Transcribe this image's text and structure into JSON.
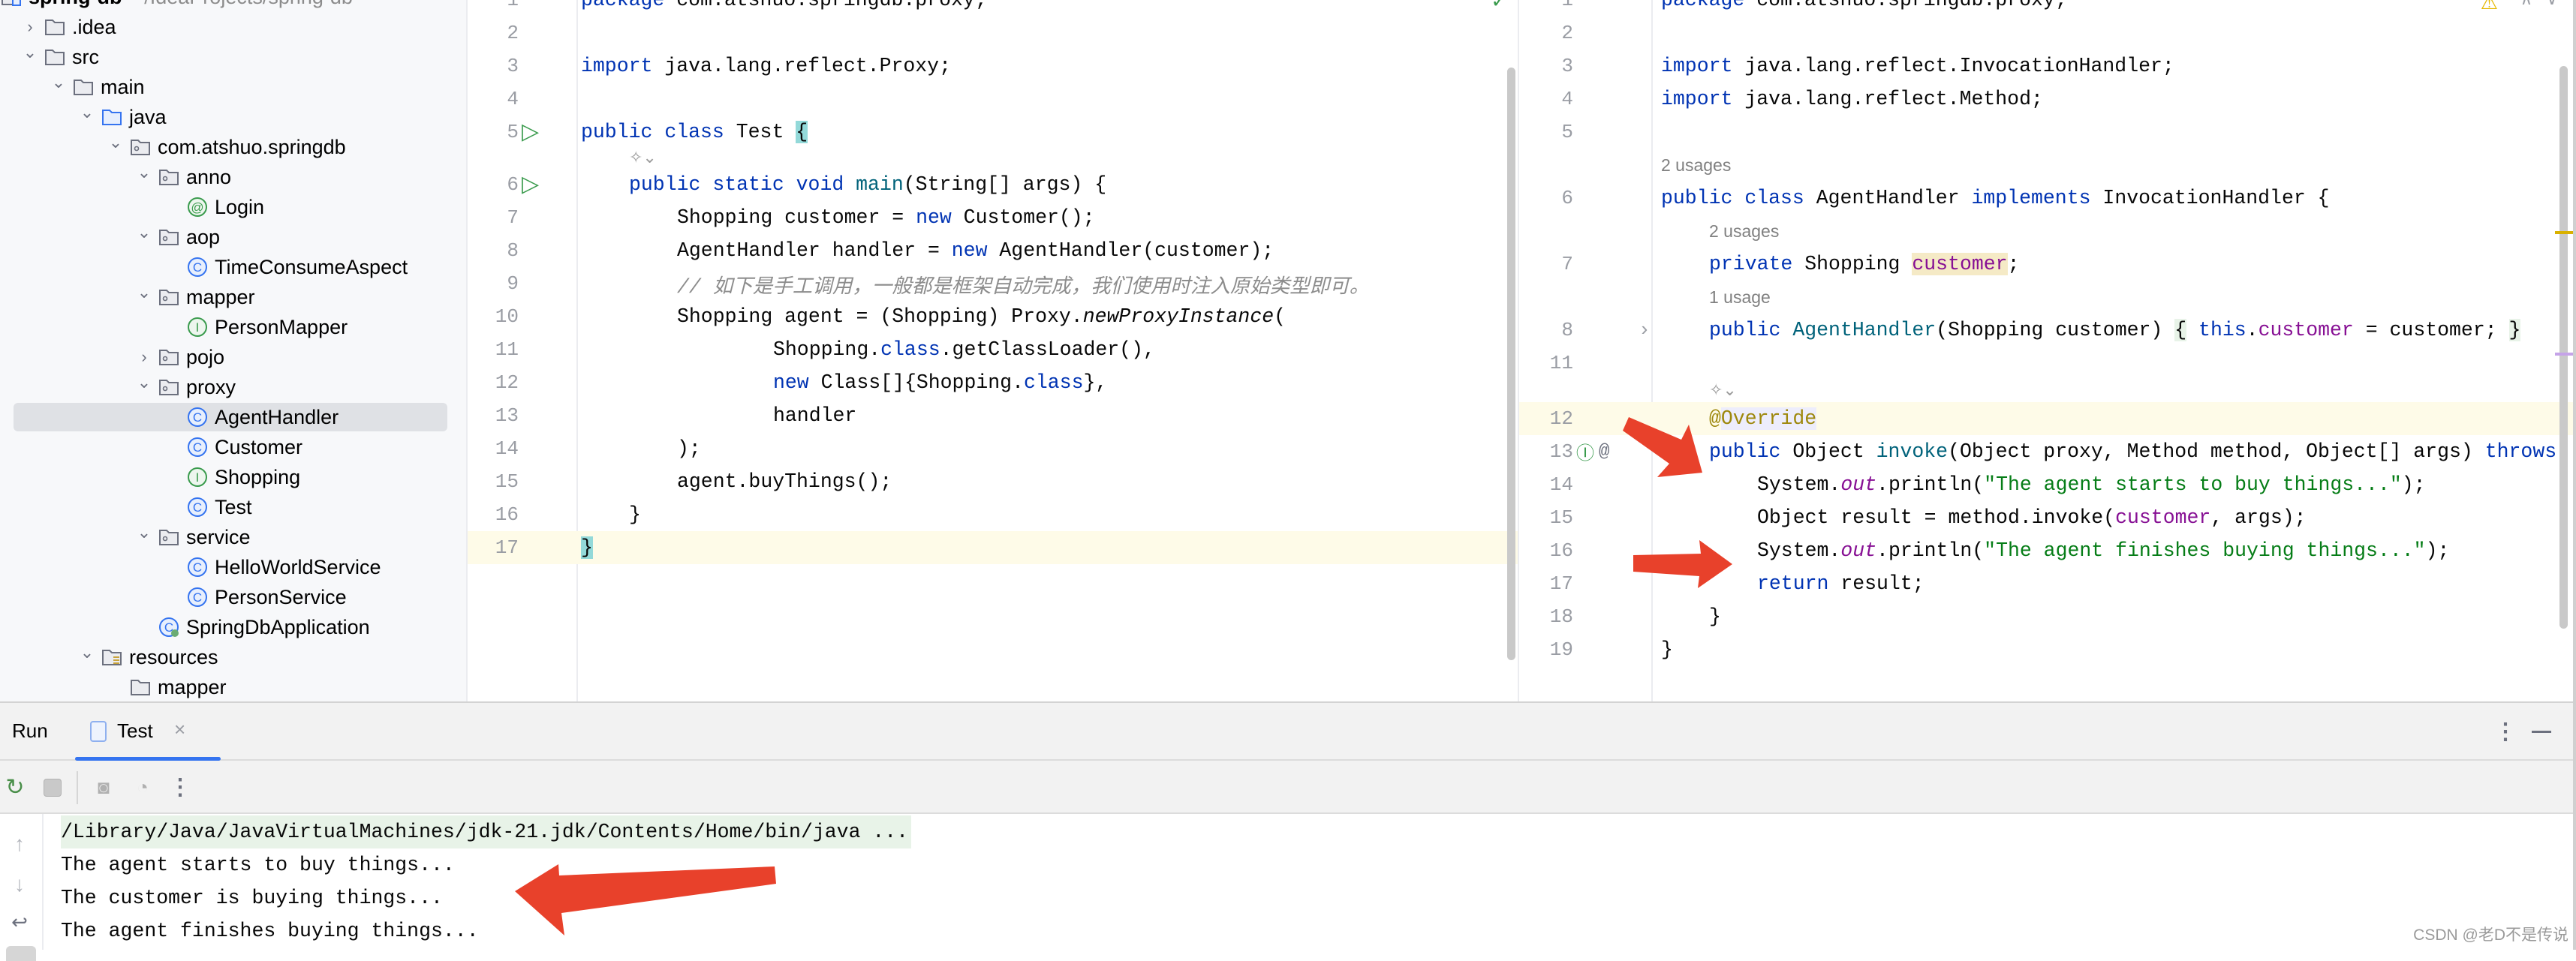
{
  "project_tree": {
    "items": [
      {
        "label": "spring-db",
        "sub": "~/IdeaProjects/spring-db",
        "depth": 0,
        "icon": "module-folder",
        "chevron": "none",
        "bold": true
      },
      {
        "label": ".idea",
        "depth": 1,
        "icon": "folder",
        "chevron": "right"
      },
      {
        "label": "src",
        "depth": 1,
        "icon": "folder",
        "chevron": "down"
      },
      {
        "label": "main",
        "depth": 2,
        "icon": "folder",
        "chevron": "down"
      },
      {
        "label": "java",
        "depth": 3,
        "icon": "source-folder",
        "chevron": "down"
      },
      {
        "label": "com.atshuo.springdb",
        "depth": 4,
        "icon": "package",
        "chevron": "down"
      },
      {
        "label": "anno",
        "depth": 5,
        "icon": "package",
        "chevron": "down"
      },
      {
        "label": "Login",
        "depth": 6,
        "icon": "annotation",
        "chevron": "none"
      },
      {
        "label": "aop",
        "depth": 5,
        "icon": "package",
        "chevron": "down"
      },
      {
        "label": "TimeConsumeAspect",
        "depth": 6,
        "icon": "class",
        "chevron": "none"
      },
      {
        "label": "mapper",
        "depth": 5,
        "icon": "package",
        "chevron": "down"
      },
      {
        "label": "PersonMapper",
        "depth": 6,
        "icon": "interface",
        "chevron": "none"
      },
      {
        "label": "pojo",
        "depth": 5,
        "icon": "package",
        "chevron": "right"
      },
      {
        "label": "proxy",
        "depth": 5,
        "icon": "package",
        "chevron": "down"
      },
      {
        "label": "AgentHandler",
        "depth": 6,
        "icon": "class",
        "chevron": "none",
        "selected": true
      },
      {
        "label": "Customer",
        "depth": 6,
        "icon": "class",
        "chevron": "none"
      },
      {
        "label": "Shopping",
        "depth": 6,
        "icon": "interface",
        "chevron": "none"
      },
      {
        "label": "Test",
        "depth": 6,
        "icon": "class",
        "chevron": "none"
      },
      {
        "label": "service",
        "depth": 5,
        "icon": "package",
        "chevron": "down"
      },
      {
        "label": "HelloWorldService",
        "depth": 6,
        "icon": "class",
        "chevron": "none"
      },
      {
        "label": "PersonService",
        "depth": 6,
        "icon": "class",
        "chevron": "none"
      },
      {
        "label": "SpringDbApplication",
        "depth": 5,
        "icon": "spring-app",
        "chevron": "none"
      },
      {
        "label": "resources",
        "depth": 3,
        "icon": "resources-folder",
        "chevron": "down"
      },
      {
        "label": "mapper",
        "depth": 4,
        "icon": "folder",
        "chevron": "none"
      }
    ]
  },
  "editor_left": {
    "file": "Test",
    "status_icon": "check-icon",
    "lines": [
      {
        "n": "1",
        "kind": "code",
        "indent": 0,
        "tokens": [
          [
            "package",
            "kw"
          ],
          [
            " com.atshuo.springdb.proxy;",
            "pl"
          ]
        ]
      },
      {
        "n": "2",
        "kind": "code",
        "indent": 0,
        "tokens": []
      },
      {
        "n": "3",
        "kind": "code",
        "indent": 0,
        "tokens": [
          [
            "import",
            "kw"
          ],
          [
            " java.lang.reflect.Proxy;",
            "pl"
          ]
        ]
      },
      {
        "n": "4",
        "kind": "code",
        "indent": 0,
        "tokens": []
      },
      {
        "n": "5",
        "kind": "code",
        "indent": 0,
        "gutter": "run",
        "tokens": [
          [
            "public class",
            "kw"
          ],
          [
            " Test ",
            "pl"
          ],
          [
            "{",
            "pl hl-brace"
          ]
        ]
      },
      {
        "kind": "hint-icon",
        "indent": 1
      },
      {
        "n": "6",
        "kind": "code",
        "indent": 1,
        "gutter": "run",
        "tokens": [
          [
            "public static void",
            "kw"
          ],
          [
            " ",
            "pl"
          ],
          [
            "main",
            "fn"
          ],
          [
            "(String[] args) {",
            "pl"
          ]
        ]
      },
      {
        "n": "7",
        "kind": "code",
        "indent": 2,
        "tokens": [
          [
            "Shopping customer = ",
            "pl"
          ],
          [
            "new",
            "kw"
          ],
          [
            " Customer();",
            "pl"
          ]
        ]
      },
      {
        "n": "8",
        "kind": "code",
        "indent": 2,
        "tokens": [
          [
            "AgentHandler handler = ",
            "pl"
          ],
          [
            "new",
            "kw"
          ],
          [
            " AgentHandler(customer);",
            "pl"
          ]
        ]
      },
      {
        "n": "9",
        "kind": "code",
        "indent": 2,
        "tokens": [
          [
            "// 如下是手工调用，一般都是框架自动完成，我们使用时注入原始类型即可。",
            "cmt"
          ]
        ]
      },
      {
        "n": "10",
        "kind": "code",
        "indent": 2,
        "tokens": [
          [
            "Shopping agent = (Shopping) Proxy.",
            "pl"
          ],
          [
            "newProxyInstance",
            "pl it"
          ],
          [
            "(",
            "pl"
          ]
        ]
      },
      {
        "n": "11",
        "kind": "code",
        "indent": 4,
        "tokens": [
          [
            "Shopping.",
            "pl"
          ],
          [
            "class",
            "kw"
          ],
          [
            ".getClassLoader(),",
            "pl"
          ]
        ]
      },
      {
        "n": "12",
        "kind": "code",
        "indent": 4,
        "tokens": [
          [
            "new",
            "kw"
          ],
          [
            " Class[]{Shopping.",
            "pl"
          ],
          [
            "class",
            "kw"
          ],
          [
            "},",
            "pl"
          ]
        ]
      },
      {
        "n": "13",
        "kind": "code",
        "indent": 4,
        "tokens": [
          [
            "handler",
            "pl"
          ]
        ]
      },
      {
        "n": "14",
        "kind": "code",
        "indent": 2,
        "tokens": [
          [
            ");",
            "pl"
          ]
        ]
      },
      {
        "n": "15",
        "kind": "code",
        "indent": 2,
        "tokens": [
          [
            "agent.buyThings();",
            "pl"
          ]
        ]
      },
      {
        "n": "16",
        "kind": "code",
        "indent": 1,
        "tokens": [
          [
            "}",
            "pl"
          ]
        ]
      },
      {
        "n": "17",
        "kind": "code",
        "indent": 0,
        "current": true,
        "tokens": [
          [
            "}",
            "pl hl-brace"
          ]
        ]
      }
    ]
  },
  "editor_right": {
    "file": "AgentHandler",
    "status_icon": "warning-icon",
    "lines": [
      {
        "n": "1",
        "kind": "code",
        "indent": 0,
        "tokens": [
          [
            "package",
            "kw"
          ],
          [
            " com.atshuo.springdb.proxy;",
            "pl"
          ]
        ]
      },
      {
        "n": "2",
        "kind": "code",
        "indent": 0,
        "tokens": []
      },
      {
        "n": "3",
        "kind": "code",
        "indent": 0,
        "tokens": [
          [
            "import",
            "kw"
          ],
          [
            " java.lang.reflect.InvocationHandler;",
            "pl"
          ]
        ]
      },
      {
        "n": "4",
        "kind": "code",
        "indent": 0,
        "tokens": [
          [
            "import",
            "kw"
          ],
          [
            " java.lang.reflect.Method;",
            "pl"
          ]
        ]
      },
      {
        "n": "5",
        "kind": "code",
        "indent": 0,
        "tokens": []
      },
      {
        "kind": "hint",
        "indent": 0,
        "text": "2 usages"
      },
      {
        "n": "6",
        "kind": "code",
        "indent": 0,
        "tokens": [
          [
            "public class",
            "kw"
          ],
          [
            " AgentHandler ",
            "pl"
          ],
          [
            "implements",
            "kw"
          ],
          [
            " InvocationHandler {",
            "pl"
          ]
        ]
      },
      {
        "kind": "hint",
        "indent": 1,
        "text": "2 usages"
      },
      {
        "n": "7",
        "kind": "code",
        "indent": 1,
        "tokens": [
          [
            "private",
            "kw"
          ],
          [
            " Shopping ",
            "pl"
          ],
          [
            "customer",
            "fld hl-var"
          ],
          [
            ";",
            "pl"
          ]
        ]
      },
      {
        "kind": "hint",
        "indent": 1,
        "text": "1 usage"
      },
      {
        "n": "8",
        "kind": "code",
        "indent": 1,
        "gutter": "fold",
        "tokens": [
          [
            "public",
            "kw"
          ],
          [
            " ",
            "pl"
          ],
          [
            "AgentHandler",
            "fn"
          ],
          [
            "(Shopping customer) ",
            "pl"
          ],
          [
            "{",
            "pl hl-fold"
          ],
          [
            " ",
            "pl"
          ],
          [
            "this",
            "kw"
          ],
          [
            ".",
            "pl"
          ],
          [
            "customer",
            "fld"
          ],
          [
            " = customer; ",
            "pl"
          ],
          [
            "}",
            "pl hl-fold"
          ]
        ]
      },
      {
        "n": "11",
        "kind": "code",
        "indent": 0,
        "tokens": []
      },
      {
        "kind": "hint-icon",
        "indent": 1
      },
      {
        "n": "12",
        "kind": "code",
        "indent": 1,
        "current": true,
        "tokens": [
          [
            "@",
            "ann"
          ],
          [
            "Override",
            "ann hl-ann"
          ]
        ]
      },
      {
        "n": "13",
        "kind": "code",
        "indent": 1,
        "gutter": "implements",
        "tokens": [
          [
            "public",
            "kw"
          ],
          [
            " Object ",
            "pl"
          ],
          [
            "invoke",
            "fn"
          ],
          [
            "(Object proxy, Method method, Object[] args) ",
            "pl"
          ],
          [
            "throws",
            "kw"
          ]
        ]
      },
      {
        "n": "14",
        "kind": "code",
        "indent": 2,
        "tokens": [
          [
            "System.",
            "pl"
          ],
          [
            "out",
            "ifld"
          ],
          [
            ".println(",
            "pl"
          ],
          [
            "\"The agent starts to buy things...\"",
            "str"
          ],
          [
            ");",
            "pl"
          ]
        ]
      },
      {
        "n": "15",
        "kind": "code",
        "indent": 2,
        "tokens": [
          [
            "Object result = method.invoke(",
            "pl"
          ],
          [
            "customer",
            "fld"
          ],
          [
            ", args);",
            "pl"
          ]
        ]
      },
      {
        "n": "16",
        "kind": "code",
        "indent": 2,
        "tokens": [
          [
            "System.",
            "pl"
          ],
          [
            "out",
            "ifld"
          ],
          [
            ".println(",
            "pl"
          ],
          [
            "\"The agent finishes buying things...\"",
            "str"
          ],
          [
            ");",
            "pl"
          ]
        ]
      },
      {
        "n": "17",
        "kind": "code",
        "indent": 2,
        "tokens": [
          [
            "return",
            "kw"
          ],
          [
            " result;",
            "pl"
          ]
        ]
      },
      {
        "n": "18",
        "kind": "code",
        "indent": 1,
        "tokens": [
          [
            "}",
            "pl"
          ]
        ]
      },
      {
        "n": "19",
        "kind": "code",
        "indent": 0,
        "tokens": [
          [
            "}",
            "pl"
          ]
        ]
      }
    ]
  },
  "run_panel": {
    "title": "Run",
    "tab_label": "Test",
    "close_glyph": "×",
    "console": [
      {
        "text": "/Library/Java/JavaVirtualMachines/jdk-21.jdk/Contents/Home/bin/java ...",
        "kind": "cmd"
      },
      {
        "text": "The agent starts to buy things...",
        "kind": "out"
      },
      {
        "text": "The customer is buying things...",
        "kind": "out"
      },
      {
        "text": "The agent finishes buying things...",
        "kind": "out"
      }
    ]
  },
  "watermark": "CSDN @老D不是传说",
  "colors": {
    "keyword": "#0033b3",
    "string": "#067d17",
    "field": "#871094",
    "annotation": "#9e880d",
    "accent": "#3574f0",
    "arrow": "#e8412b"
  }
}
